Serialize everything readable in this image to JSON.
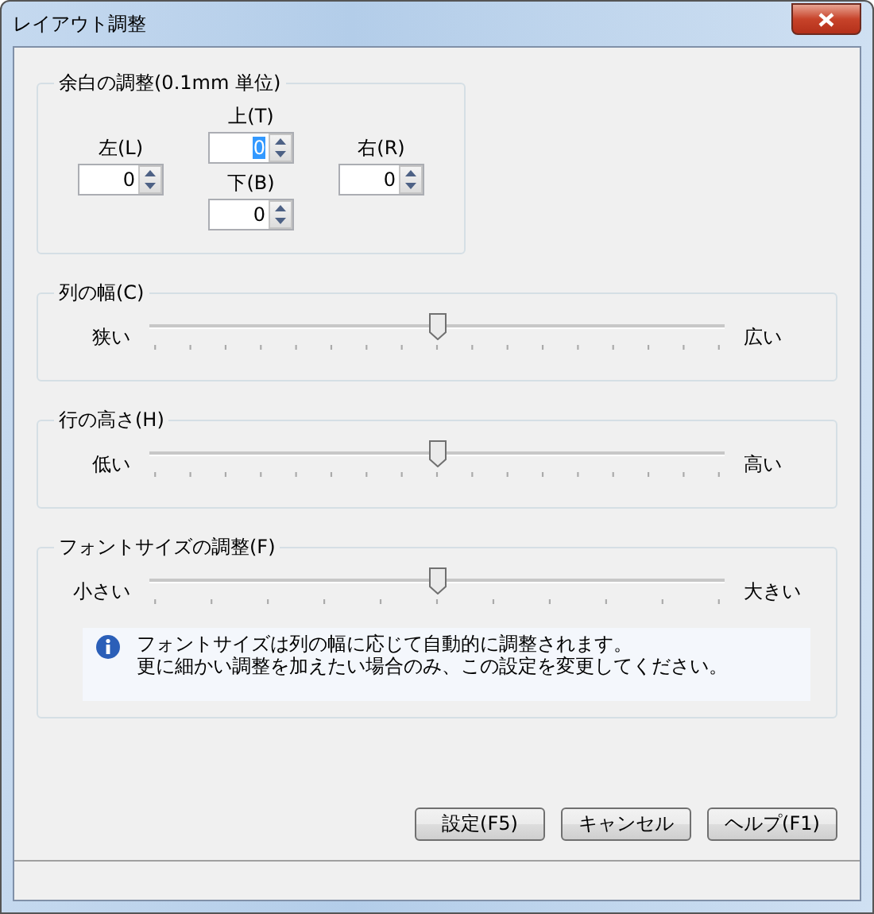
{
  "window": {
    "title": "レイアウト調整"
  },
  "margins": {
    "title": "余白の調整(0.1mm 単位)",
    "fields": [
      {
        "label": "上(T)",
        "value": "0",
        "selected": true
      },
      {
        "label": "左(L)",
        "value": "0",
        "selected": false
      },
      {
        "label": "右(R)",
        "value": "0",
        "selected": false
      },
      {
        "label": "下(B)",
        "value": "0",
        "selected": false
      }
    ]
  },
  "sliders": [
    {
      "title": "列の幅(C)",
      "min_label": "狭い",
      "max_label": "広い",
      "level": 0.5
    },
    {
      "title": "行の高さ(H)",
      "min_label": "低い",
      "max_label": "高い",
      "level": 0.5
    },
    {
      "title": "フォントサイズの調整(F)",
      "min_label": "小さい",
      "max_label": "大きい",
      "level": 0.5,
      "info_lines": [
        "フォントサイズは列の幅に応じて自動的に調整されます。",
        "更に細かい調整を加えたい場合のみ、この設定を変更してください。"
      ]
    }
  ],
  "buttons": [
    "設定(F5)",
    "キャンセル",
    "ヘルプ(F1)"
  ]
}
